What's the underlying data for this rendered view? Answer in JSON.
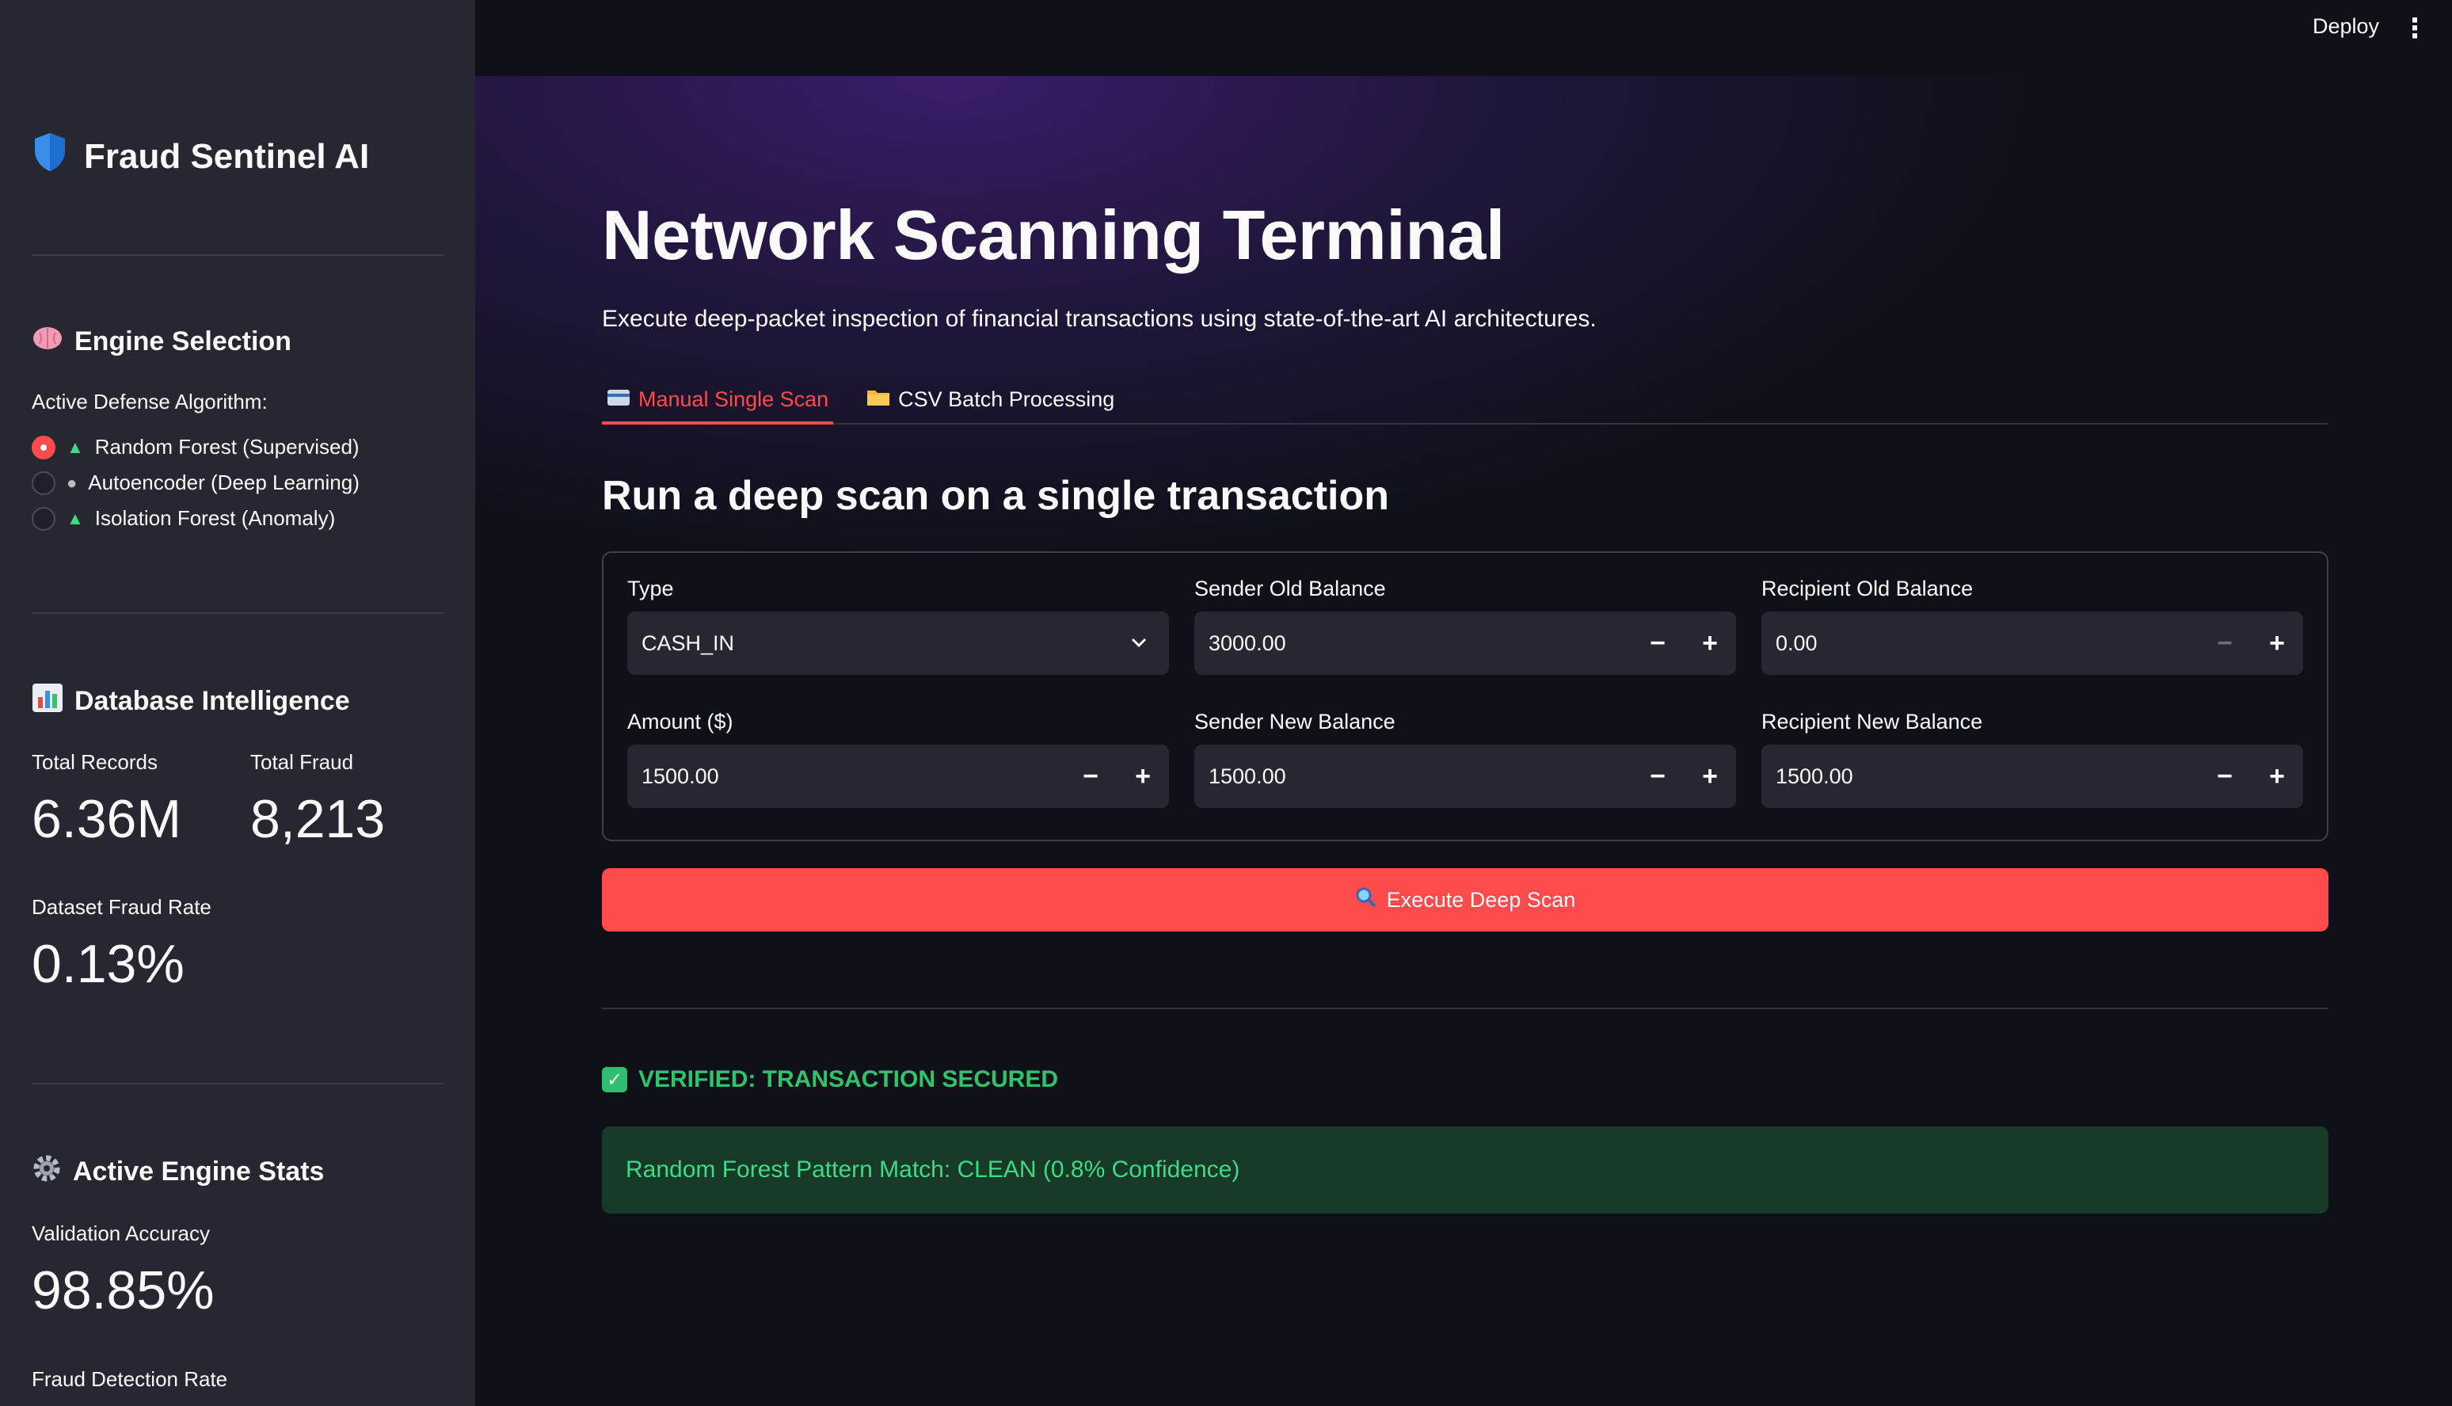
{
  "app": {
    "deploy_label": "Deploy",
    "menu_icon": "kebab-menu-icon"
  },
  "sidebar": {
    "brand": {
      "title": "Fraud Sentinel AI",
      "icon": "shield-icon"
    },
    "engine": {
      "heading": "Engine Selection",
      "heading_icon": "brain-icon",
      "label": "Active Defense Algorithm:",
      "options": [
        {
          "label": "Random Forest (Supervised)",
          "icon": "tree-icon",
          "selected": true
        },
        {
          "label": "Autoencoder (Deep Learning)",
          "icon": "robot-icon",
          "selected": false
        },
        {
          "label": "Isolation Forest (Anomaly)",
          "icon": "tree-icon",
          "selected": false
        }
      ]
    },
    "database": {
      "heading": "Database Intelligence",
      "heading_icon": "bar-chart-icon",
      "total_records_label": "Total Records",
      "total_records_value": "6.36M",
      "total_fraud_label": "Total Fraud",
      "total_fraud_value": "8,213",
      "fraud_rate_label": "Dataset Fraud Rate",
      "fraud_rate_value": "0.13%"
    },
    "stats": {
      "heading": "Active Engine Stats",
      "heading_icon": "gear-icon",
      "accuracy_label": "Validation Accuracy",
      "accuracy_value": "98.85%",
      "detection_label": "Fraud Detection Rate"
    }
  },
  "main": {
    "title": "Network Scanning Terminal",
    "subtitle": "Execute deep-packet inspection of financial transactions using state-of-the-art AI architectures.",
    "tabs": [
      {
        "label": "Manual Single Scan",
        "icon": "credit-card-icon",
        "active": true
      },
      {
        "label": "CSV Batch Processing",
        "icon": "folder-icon",
        "active": false
      }
    ],
    "section_heading": "Run a deep scan on a single transaction",
    "form": {
      "type": {
        "label": "Type",
        "value": "CASH_IN"
      },
      "sender_old": {
        "label": "Sender Old Balance",
        "value": "3000.00"
      },
      "recipient_old": {
        "label": "Recipient Old Balance",
        "value": "0.00"
      },
      "amount": {
        "label": "Amount ($)",
        "value": "1500.00"
      },
      "sender_new": {
        "label": "Sender New Balance",
        "value": "1500.00"
      },
      "recipient_new": {
        "label": "Recipient New Balance",
        "value": "1500.00"
      }
    },
    "scan_button": {
      "label": "Execute Deep Scan",
      "icon": "magnifier-icon"
    },
    "status": {
      "label": "VERIFIED: TRANSACTION SECURED",
      "icon": "checkmark-icon"
    },
    "result": {
      "text": "Random Forest Pattern Match: CLEAN (0.8% Confidence)"
    }
  },
  "colors": {
    "accent": "#ff4b4b",
    "success": "#2fc46b",
    "sidebar_bg": "#262730",
    "main_bg": "#0e1117"
  }
}
